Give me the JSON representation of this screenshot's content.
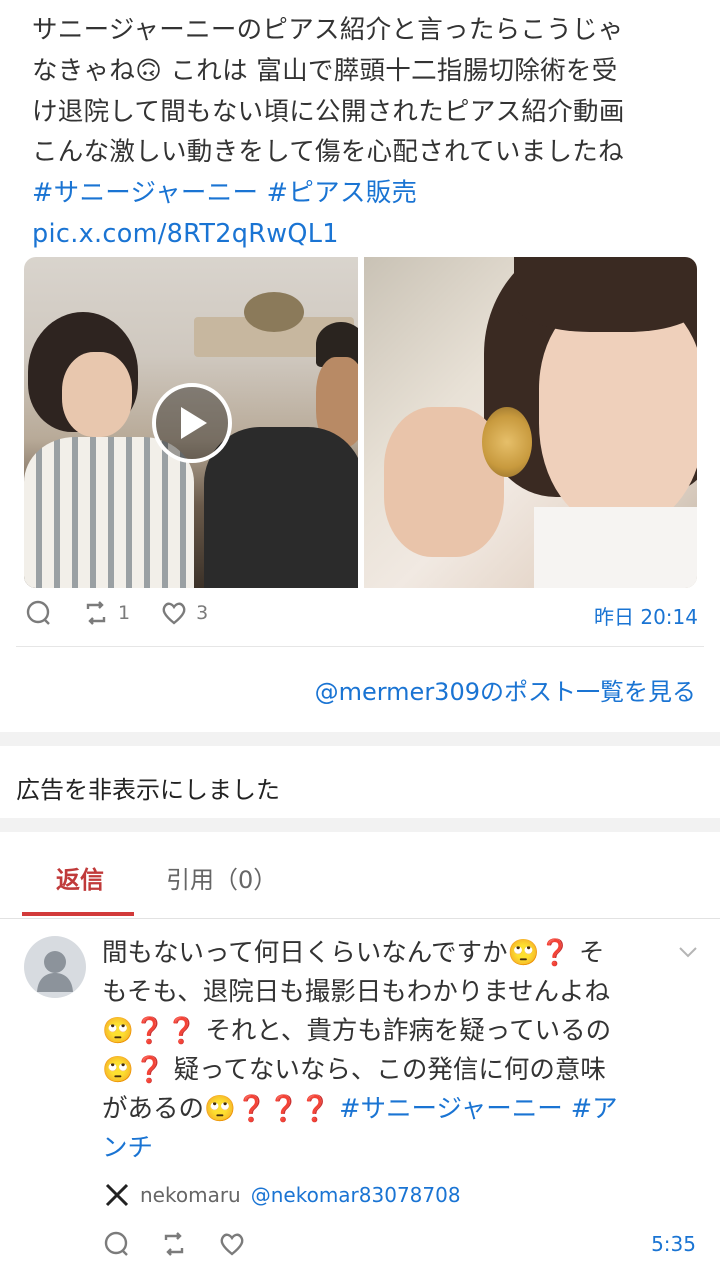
{
  "post": {
    "lines": [
      "サニージャーニーのピアス紹介と言ったらこうじゃ",
      "なきゃね🙃 これは 富山で膵頭十二指腸切除術を受",
      "け退院して間もない頃に公開されたピアス紹介動画",
      "こんな激しい動きをして傷を心配されていましたね"
    ],
    "hashtags": "#サニージャーニー #ピアス販売",
    "media_link": "pic.x.com/8RT2qRwQL1",
    "retweet_count": "1",
    "like_count": "3",
    "timestamp": "昨日 20:14"
  },
  "more_posts_link": "@mermer309のポスト一覧を見る",
  "ad_notice": "広告を非表示にしました",
  "tabs": {
    "replies": "返信",
    "quotes": "引用（0）"
  },
  "reply": {
    "lines": [
      "間もないって何日くらいなんですか🙄❓ そ",
      "もそも、退院日も撮影日もわかりませんよね",
      "🙄❓❓ それと、貴方も詐病を疑っているの",
      "🙄❓ 疑ってないなら、この発信に何の意味",
      "があるの🙄❓❓❓ "
    ],
    "hashtag_inline": "#サニージャーニー #ア",
    "hashtag_tail": "ンチ",
    "author_name": "nekomaru",
    "author_handle": "@nekomar83078708",
    "time": "5:35"
  },
  "colors": {
    "link": "#1a74d3",
    "active_tab": "#c03a3a",
    "muted": "#7b7b7b"
  },
  "icons": [
    "reply-icon",
    "retweet-icon",
    "heart-icon",
    "play-icon",
    "chevron-down-icon",
    "x-logo-icon",
    "avatar-placeholder-icon"
  ]
}
